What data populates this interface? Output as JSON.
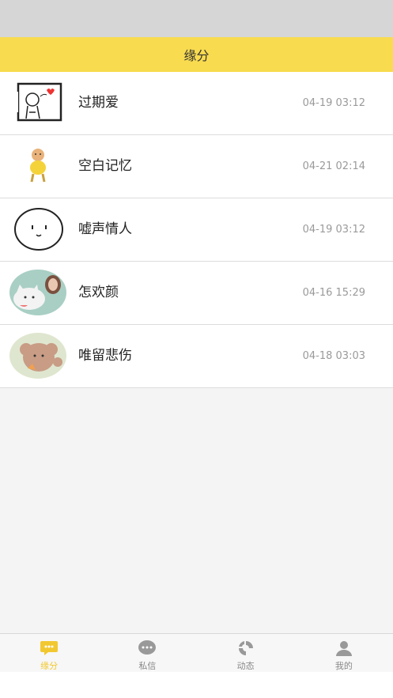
{
  "header": {
    "title": "缘分"
  },
  "chats": [
    {
      "name": "过期爱",
      "time": "04-19 03:12"
    },
    {
      "name": "空白记忆",
      "time": "04-21 02:14"
    },
    {
      "name": "嘘声情人",
      "time": "04-19 03:12"
    },
    {
      "name": "怎欢颜",
      "time": "04-16 15:29"
    },
    {
      "name": "唯留悲伤",
      "time": "04-18 03:03"
    }
  ],
  "tabs": [
    {
      "label": "缘分",
      "icon": "chat-bubble-icon",
      "active": true
    },
    {
      "label": "私信",
      "icon": "message-dots-icon",
      "active": false
    },
    {
      "label": "动态",
      "icon": "swirl-icon",
      "active": false
    },
    {
      "label": "我的",
      "icon": "person-icon",
      "active": false
    }
  ],
  "colors": {
    "accent": "#f8db4f",
    "active_tab": "#f2c830",
    "inactive_tab": "#888888"
  }
}
